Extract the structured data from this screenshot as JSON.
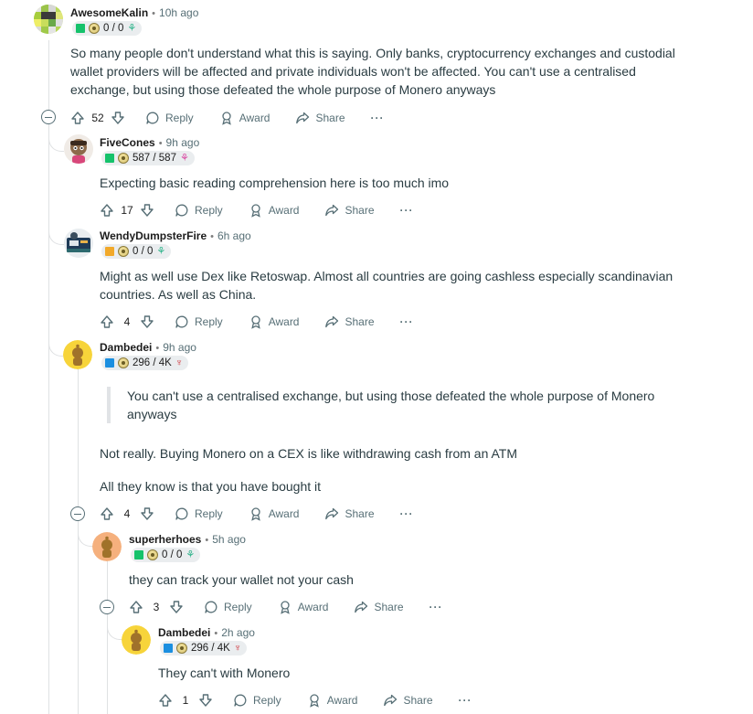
{
  "comments": [
    {
      "username": "AwesomeKalin",
      "time": "10h ago",
      "flair": {
        "color": "#15c26b",
        "karma": "0 / 0",
        "badge": "squid-icon",
        "badge_color": "#2db38a"
      },
      "body": [
        "So many people don't understand what this is saying. Only banks, cryptocurrency exchanges and custodial wallet providers will be affected and private individuals won't be affected. You can't use a centralised exchange, but using those defeated the whole purpose of Monero anyways"
      ],
      "votes": "52",
      "collapse": true
    },
    {
      "username": "FiveCones",
      "time": "9h ago",
      "flair": {
        "color": "#15c26b",
        "karma": "587 / 587",
        "badge": "squid-icon",
        "badge_color": "#d94aa2"
      },
      "body": [
        "Expecting basic reading comprehension here is too much imo"
      ],
      "votes": "17"
    },
    {
      "username": "WendyDumpsterFire",
      "time": "6h ago",
      "flair": {
        "color": "#f2a92a",
        "karma": "0 / 0",
        "badge": "squid-icon",
        "badge_color": "#2db38a"
      },
      "body": [
        "Might as well use Dex like Retoswap. Almost all countries are going cashless especially scandinavian countries. As well as China."
      ],
      "votes": "4"
    },
    {
      "username": "Dambedei",
      "time": "9h ago",
      "flair": {
        "color": "#1b8fe0",
        "karma": "296 / 4K",
        "badge": "lobster-icon",
        "badge_color": "#d0343a"
      },
      "quote": "You can't use a centralised exchange, but using those defeated the whole purpose of Monero anyways",
      "body": [
        "Not really. Buying Monero on a CEX is like withdrawing cash from an ATM",
        "All they know is that you have bought it"
      ],
      "votes": "4",
      "collapse": true
    },
    {
      "username": "superherhoes",
      "time": "5h ago",
      "flair": {
        "color": "#15c26b",
        "karma": "0 / 0",
        "badge": "squid-icon",
        "badge_color": "#2db38a"
      },
      "body": [
        "they can track your wallet not your cash"
      ],
      "votes": "3",
      "collapse": true
    },
    {
      "username": "Dambedei",
      "time": "2h ago",
      "flair": {
        "color": "#1b8fe0",
        "karma": "296 / 4K",
        "badge": "lobster-icon",
        "badge_color": "#d0343a"
      },
      "body": [
        "They can't with Monero"
      ],
      "votes": "1"
    }
  ],
  "labels": {
    "reply": "Reply",
    "award": "Award",
    "share": "Share",
    "more": "···",
    "separator": "•"
  },
  "colors": {
    "text_body": "#2a3c42",
    "meta_grey": "#576f76",
    "thread_line": "#dfe1e3",
    "flair_bg": "#eaedef"
  }
}
